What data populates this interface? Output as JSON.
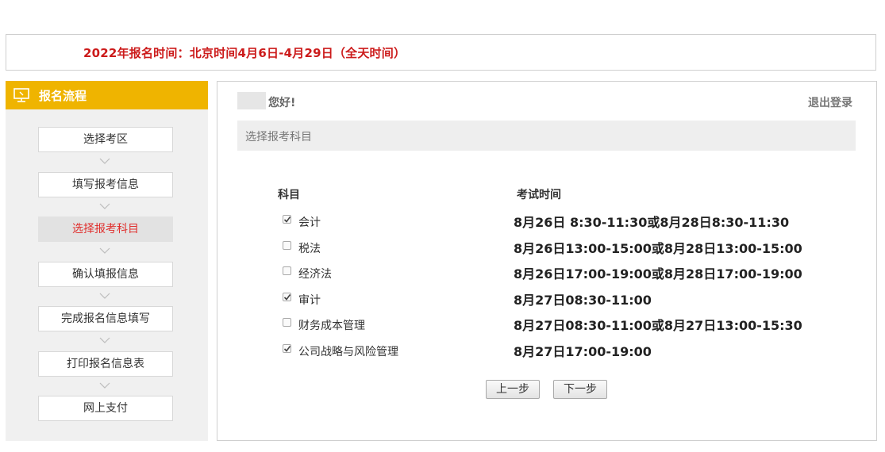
{
  "notice": {
    "text": "2022年报名时间：北京时间4月6日-4月29日（全天时间）"
  },
  "sidebar": {
    "title": "报名流程",
    "steps": [
      {
        "label": "选择考区",
        "active": false
      },
      {
        "label": "填写报考信息",
        "active": false
      },
      {
        "label": "选择报考科目",
        "active": true
      },
      {
        "label": "确认填报信息",
        "active": false
      },
      {
        "label": "完成报名信息填写",
        "active": false
      },
      {
        "label": "打印报名信息表",
        "active": false
      },
      {
        "label": "网上支付",
        "active": false
      }
    ]
  },
  "main": {
    "greeting": "您好!",
    "logout": "退出登录",
    "section_title": "选择报考科目",
    "col_subject": "科目",
    "col_time": "考试时间",
    "subjects": [
      {
        "name": "会计",
        "time": "8月26日 8:30-11:30或8月28日8:30-11:30",
        "checked": true
      },
      {
        "name": "税法",
        "time": "8月26日13:00-15:00或8月28日13:00-15:00",
        "checked": false
      },
      {
        "name": "经济法",
        "time": "8月26日17:00-19:00或8月28日17:00-19:00",
        "checked": false
      },
      {
        "name": "审计",
        "time": "8月27日08:30-11:00",
        "checked": true
      },
      {
        "name": "财务成本管理",
        "time": "8月27日08:30-11:00或8月27日13:00-15:30",
        "checked": false
      },
      {
        "name": "公司战略与风险管理",
        "time": "8月27日17:00-19:00",
        "checked": true
      }
    ],
    "prev_label": "上一步",
    "next_label": "下一步"
  },
  "colors": {
    "accent": "#efb400",
    "notice_red": "#cc1b1b",
    "active_red": "#e0302e"
  },
  "icons": {
    "sidebar_header": "monitor-icon",
    "step_separator": "chevron-down-icon",
    "checkbox_mark": "check-icon"
  }
}
